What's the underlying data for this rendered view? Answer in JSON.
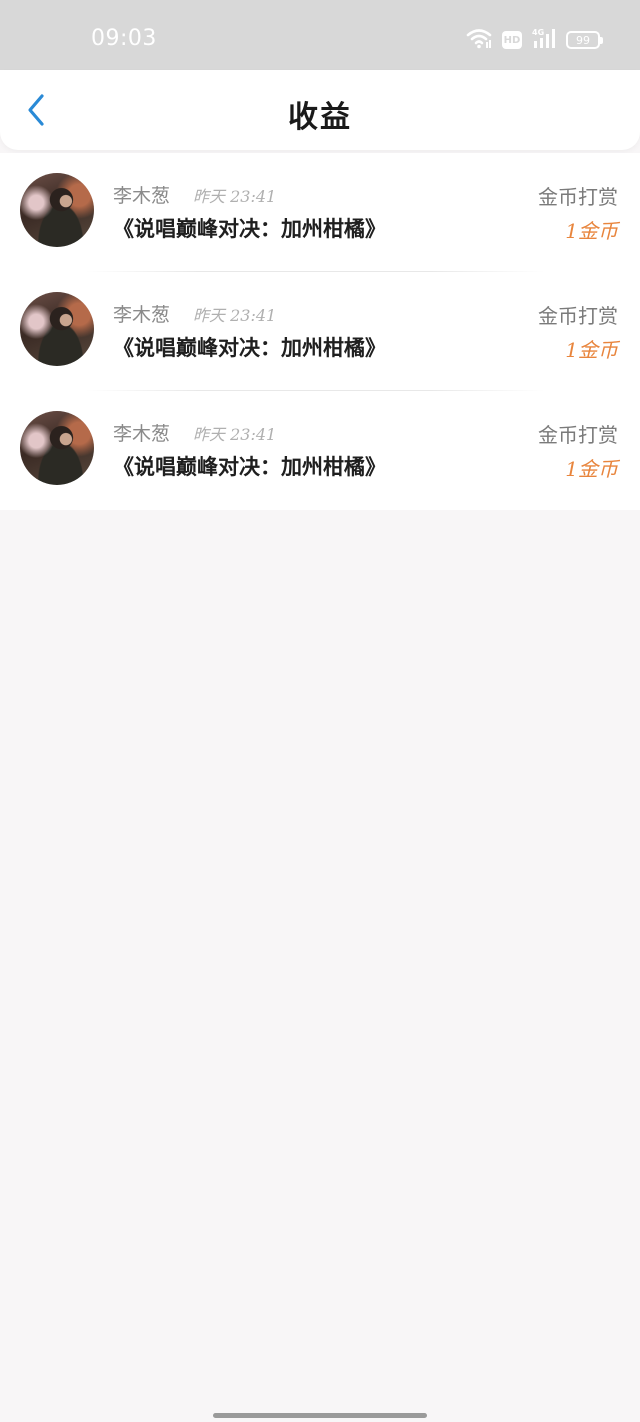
{
  "status_bar": {
    "time": "09:03",
    "icons": [
      "wifi-icon",
      "hd-icon",
      "signal-4g-icon",
      "battery-icon"
    ],
    "hd_label": "HD",
    "network_label": "4G",
    "battery_level": "99"
  },
  "header": {
    "title": "收益",
    "back_icon": "chevron-left-icon",
    "accent_color": "#2a8ad6"
  },
  "earnings": [
    {
      "user_name": "李木葱",
      "timestamp": "昨天 23:41",
      "work_title": "《说唱巅峰对决：加州柑橘》",
      "reward_type": "金币打赏",
      "reward_amount": "1金币"
    },
    {
      "user_name": "李木葱",
      "timestamp": "昨天 23:41",
      "work_title": "《说唱巅峰对决：加州柑橘》",
      "reward_type": "金币打赏",
      "reward_amount": "1金币"
    },
    {
      "user_name": "李木葱",
      "timestamp": "昨天 23:41",
      "work_title": "《说唱巅峰对决：加州柑橘》",
      "reward_type": "金币打赏",
      "reward_amount": "1金币"
    }
  ],
  "colors": {
    "status_bar_bg": "#d8d8d8",
    "page_bg": "#f8f6f7",
    "reward_amount": "#e8853d"
  }
}
